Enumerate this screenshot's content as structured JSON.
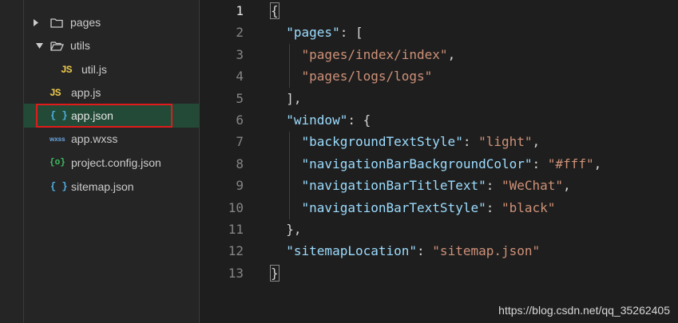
{
  "explorer": {
    "items": [
      {
        "label": "pages",
        "type": "folder",
        "expanded": false
      },
      {
        "label": "utils",
        "type": "folder",
        "expanded": true
      },
      {
        "label": "util.js",
        "type": "js",
        "icon_text": "JS"
      },
      {
        "label": "app.js",
        "type": "js",
        "icon_text": "JS"
      },
      {
        "label": "app.json",
        "type": "json",
        "icon_text": "{ }",
        "selected": true
      },
      {
        "label": "app.wxss",
        "type": "wxss",
        "icon_text": "wxss"
      },
      {
        "label": "project.config.json",
        "type": "config-json",
        "icon_text": "{o}"
      },
      {
        "label": "sitemap.json",
        "type": "json",
        "icon_text": "{ }"
      }
    ]
  },
  "editor": {
    "line_numbers": [
      "1",
      "2",
      "3",
      "4",
      "5",
      "6",
      "7",
      "8",
      "9",
      "10",
      "11",
      "12",
      "13"
    ],
    "active_line": "1",
    "lines": [
      [
        {
          "t": "p",
          "v": "{"
        }
      ],
      [
        {
          "t": "p",
          "v": "  "
        },
        {
          "t": "k",
          "v": "\"pages\""
        },
        {
          "t": "p",
          "v": ": ["
        }
      ],
      [
        {
          "t": "p",
          "v": "    "
        },
        {
          "t": "s",
          "v": "\"pages/index/index\""
        },
        {
          "t": "p",
          "v": ","
        }
      ],
      [
        {
          "t": "p",
          "v": "    "
        },
        {
          "t": "s",
          "v": "\"pages/logs/logs\""
        }
      ],
      [
        {
          "t": "p",
          "v": "  ],"
        }
      ],
      [
        {
          "t": "p",
          "v": "  "
        },
        {
          "t": "k",
          "v": "\"window\""
        },
        {
          "t": "p",
          "v": ": {"
        }
      ],
      [
        {
          "t": "p",
          "v": "    "
        },
        {
          "t": "k",
          "v": "\"backgroundTextStyle\""
        },
        {
          "t": "p",
          "v": ": "
        },
        {
          "t": "s",
          "v": "\"light\""
        },
        {
          "t": "p",
          "v": ","
        }
      ],
      [
        {
          "t": "p",
          "v": "    "
        },
        {
          "t": "k",
          "v": "\"navigationBarBackgroundColor\""
        },
        {
          "t": "p",
          "v": ": "
        },
        {
          "t": "s",
          "v": "\"#fff\""
        },
        {
          "t": "p",
          "v": ","
        }
      ],
      [
        {
          "t": "p",
          "v": "    "
        },
        {
          "t": "k",
          "v": "\"navigationBarTitleText\""
        },
        {
          "t": "p",
          "v": ": "
        },
        {
          "t": "s",
          "v": "\"WeChat\""
        },
        {
          "t": "p",
          "v": ","
        }
      ],
      [
        {
          "t": "p",
          "v": "    "
        },
        {
          "t": "k",
          "v": "\"navigationBarTextStyle\""
        },
        {
          "t": "p",
          "v": ": "
        },
        {
          "t": "s",
          "v": "\"black\""
        }
      ],
      [
        {
          "t": "p",
          "v": "  },"
        }
      ],
      [
        {
          "t": "p",
          "v": "  "
        },
        {
          "t": "k",
          "v": "\"sitemapLocation\""
        },
        {
          "t": "p",
          "v": ": "
        },
        {
          "t": "s",
          "v": "\"sitemap.json\""
        }
      ],
      [
        {
          "t": "p",
          "v": "}"
        }
      ]
    ]
  },
  "watermark": "https://blog.csdn.net/qq_35262405",
  "colors": {
    "key": "#9cdcfe",
    "string": "#ce9178",
    "punctuation": "#d4d4d4",
    "selection": "#234a36",
    "annotation_box": "#e01b1b"
  }
}
